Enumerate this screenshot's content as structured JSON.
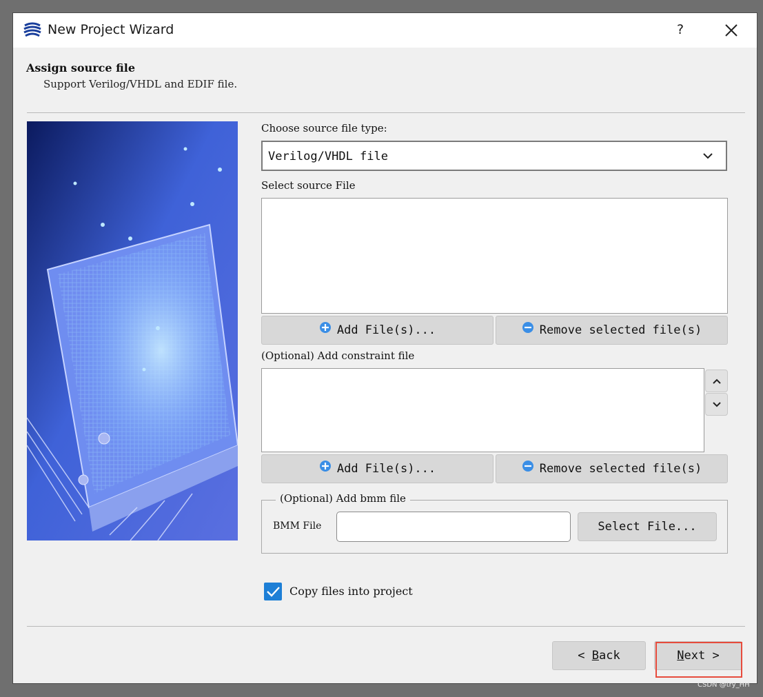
{
  "window": {
    "title": "New Project Wizard",
    "help_label": "?"
  },
  "header": {
    "title": "Assign source file",
    "subtitle": "Support Verilog/VHDL and EDIF file."
  },
  "source": {
    "type_label": "Choose source file type:",
    "type_value": "Verilog/VHDL file",
    "select_label": "Select source File",
    "add_label": "Add File(s)...",
    "remove_label": "Remove selected file(s)"
  },
  "constraint": {
    "label": "(Optional) Add constraint file",
    "add_label": "Add File(s)...",
    "remove_label": "Remove selected file(s)"
  },
  "bmm": {
    "group_label": "(Optional) Add bmm file",
    "field_label": "BMM File",
    "value": "",
    "select_label": "Select File..."
  },
  "copy": {
    "label": "Copy files into project",
    "checked": true
  },
  "nav": {
    "back_pre": "< ",
    "back_key": "B",
    "back_rest": "ack",
    "next_key": "N",
    "next_rest": "ext >"
  },
  "colors": {
    "accent": "#1d7fd6",
    "highlight": "#e74b3c"
  },
  "watermark": "CSDN @try_HH"
}
